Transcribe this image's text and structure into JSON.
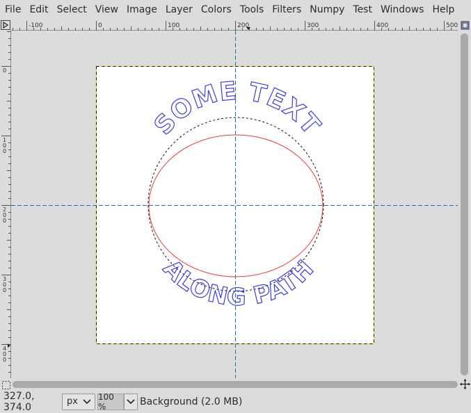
{
  "menubar": {
    "items": [
      "File",
      "Edit",
      "Select",
      "View",
      "Image",
      "Layer",
      "Colors",
      "Tools",
      "Filters",
      "Numpy",
      "Test",
      "Windows",
      "Help"
    ]
  },
  "rulers": {
    "horizontal_labels": [
      "-100",
      "0",
      "100",
      "200",
      "300",
      "400",
      "500"
    ],
    "vertical_labels": [
      "0",
      "100",
      "200",
      "300",
      "400"
    ]
  },
  "canvas": {
    "text_top": "SOME TEXT",
    "text_bottom": "ALONG PATH",
    "colors": {
      "image_bg": "#ffffff",
      "outline_text": "#3b3bdd",
      "path": "#e83a3a",
      "layer_border": "#e8d200",
      "guide": "#0a7c9c"
    }
  },
  "statusbar": {
    "coords": "327.0, 374.0",
    "unit": "px",
    "zoom": "100 %",
    "layer": "Background (2.0 MB)"
  }
}
